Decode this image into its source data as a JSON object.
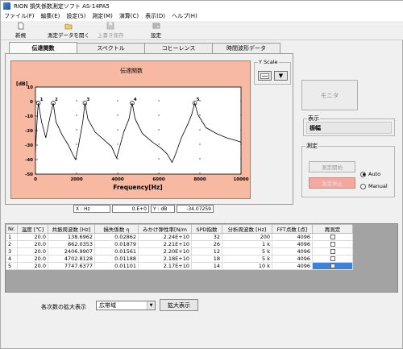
{
  "window": {
    "title": "RION 損失係数測定ソフト AS-14PA5"
  },
  "menu": [
    "ファイル(F)",
    "編集(E)",
    "設定(S)",
    "測定(M)",
    "演算(C)",
    "表示(D)",
    "ヘルプ(H)"
  ],
  "toolbar": {
    "new_label": "新規",
    "open_label": "測定データを開く",
    "save_label": "上書き保存",
    "settings_label": "設定"
  },
  "tabs": [
    "伝達関数",
    "スペクトル",
    "コヒーレンス",
    "時間波形データ"
  ],
  "yscale": {
    "title": "Y Scale"
  },
  "readout": {
    "x_label": "X : Hz",
    "x_value": "0.E+0",
    "y_label": "Y : dB",
    "y_value": "-34.07259"
  },
  "monitor_button": "モニタ",
  "display": {
    "title": "表示",
    "value": "振幅"
  },
  "measure": {
    "title": "測定",
    "start_label": "測定開始",
    "stop_label": "測定停止",
    "auto_label": "Auto",
    "manual_label": "Manual"
  },
  "table": {
    "headers": [
      "Nr.",
      "温度 [℃]",
      "共振周波数 [Hz]",
      "損失係数 η",
      "みかけ弾性率[N/m",
      "SPD指数",
      "分析周波数 [Hz]",
      "FFT点数 [点]",
      "再測定"
    ],
    "rows": [
      [
        "1",
        "20.0",
        "138.6962",
        "0.02862",
        "2.24E+10",
        "32",
        "200",
        "4096"
      ],
      [
        "2",
        "20.0",
        "862.0353",
        "0.01879",
        "2.21E+10",
        "26",
        "1 k",
        "4096"
      ],
      [
        "3",
        "20.0",
        "2406.9907",
        "0.01561",
        "2.20E+10",
        "12",
        "5 k",
        "4096"
      ],
      [
        "4",
        "20.0",
        "4702.8128",
        "0.01188",
        "2.18E+10",
        "18",
        "5 k",
        "4096"
      ],
      [
        "5",
        "20.0",
        "7747.6377",
        "0.01101",
        "2.17E+10",
        "14",
        "10 k",
        "4096"
      ]
    ]
  },
  "bottom": {
    "label": "各次数の拡大表示",
    "combo_value": "広帯域",
    "expand_button": "拡大表示"
  },
  "chart_data": {
    "type": "line",
    "title": "伝達関数",
    "xlabel": "Frequency[Hz]",
    "ylabel": "[dB]",
    "xlim": [
      0,
      10000
    ],
    "ylim": [
      -50,
      10
    ],
    "xticks": [
      "0",
      "2000",
      "4000",
      "6000",
      "8000",
      "10000"
    ],
    "yticks": [
      "10",
      "0",
      "-10",
      "-20",
      "-30",
      "-40",
      "-50"
    ],
    "peaks": [
      {
        "label": "1",
        "x": 140,
        "y": -1
      },
      {
        "label": "2",
        "x": 862,
        "y": -1
      },
      {
        "label": "3",
        "x": 2407,
        "y": -1
      },
      {
        "label": "4",
        "x": 4703,
        "y": -1
      },
      {
        "label": "5",
        "x": 7748,
        "y": -1
      }
    ],
    "x": [
      0,
      100,
      140,
      300,
      500,
      700,
      862,
      1000,
      1300,
      1600,
      1800,
      1950,
      2100,
      2300,
      2407,
      2550,
      2900,
      3300,
      3700,
      3950,
      4100,
      4300,
      4550,
      4703,
      4850,
      5200,
      5700,
      6100,
      6400,
      6650,
      6850,
      7100,
      7400,
      7600,
      7748,
      7900,
      8300,
      8800,
      9300,
      9800,
      10000
    ],
    "y": [
      -34,
      -8,
      -1,
      -14,
      -25,
      -11,
      -1,
      -14,
      -23,
      -30,
      -36,
      -40,
      -30,
      -14,
      -1,
      -12,
      -21,
      -26,
      -31,
      -39,
      -31,
      -21,
      -12,
      -1,
      -12,
      -22,
      -28,
      -32,
      -36,
      -42,
      -35,
      -25,
      -16,
      -9,
      -1,
      -9,
      -18,
      -22,
      -25,
      -27,
      -28
    ],
    "grid": false
  }
}
